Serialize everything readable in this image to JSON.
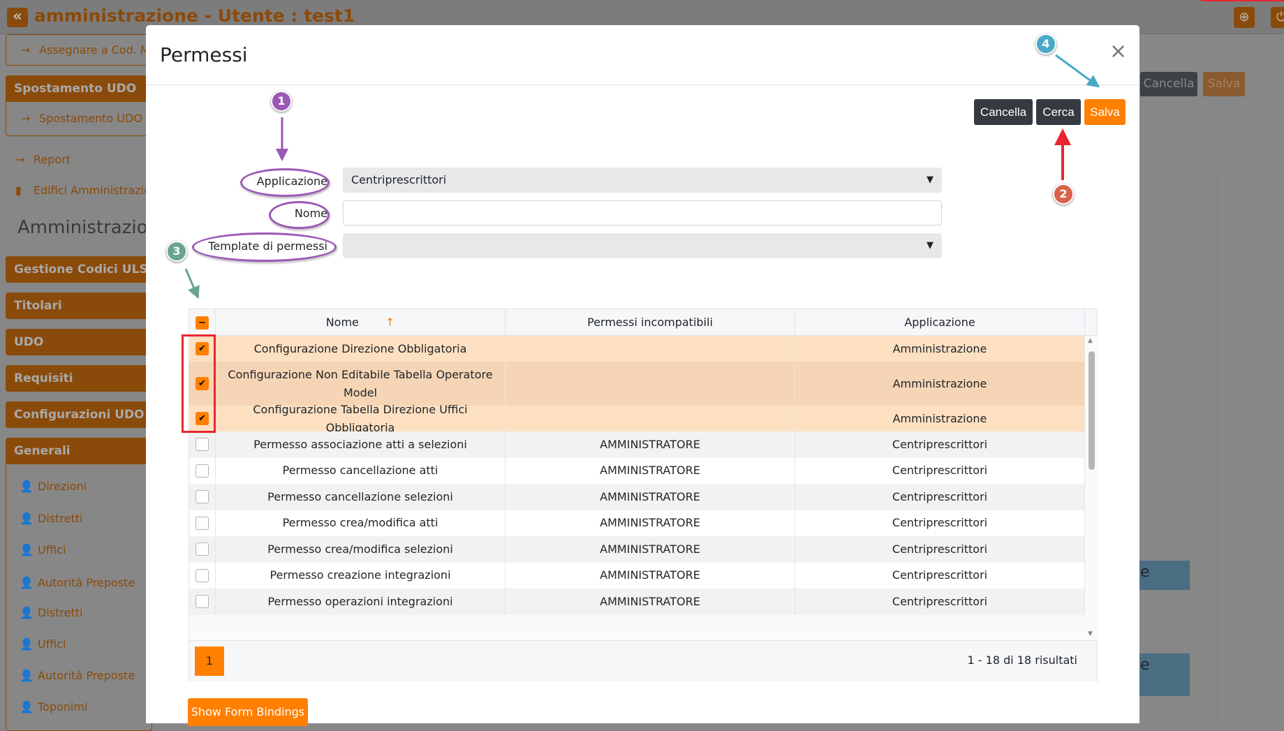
{
  "app": {
    "title": "amministrazione - Utente : test1",
    "collapse_icon": "double-chevron-left-icon",
    "globe_icon": "globe-icon",
    "power_icon": "power-icon"
  },
  "sidebar": {
    "assign_item": "Assegnare a Cod. M",
    "spostamento_header": "Spostamento UDO",
    "spostamento_item": "Spostamento UDO",
    "report": "Report",
    "edifici": "Edifici Amministrazioni",
    "heading": "Amministrazione",
    "sections": [
      "Gestione Codici ULSS",
      "Titolari",
      "UDO",
      "Requisiti",
      "Configurazioni UDO",
      "Generali"
    ],
    "generali_items": [
      "Direzioni",
      "Distretti",
      "Uffici",
      "Autorità Preposte",
      "Distretti",
      "Uffici",
      "Autorità Preposte",
      "Toponimi"
    ]
  },
  "background": {
    "cancel": "Cancella",
    "save": "Salva",
    "blue_1": "e",
    "blue_2": "e"
  },
  "modal": {
    "title": "Permessi",
    "close": "×",
    "buttons": {
      "cancel": "Cancella",
      "search": "Cerca",
      "save": "Salva"
    },
    "form": {
      "app_label": "Applicazione",
      "app_value": "Centriprescrittori",
      "name_label": "Nome",
      "name_value": "",
      "template_label": "Template di permessi",
      "template_value": ""
    },
    "table": {
      "columns": [
        "Nome",
        "Permessi incompatibili",
        "Applicazione"
      ],
      "sort": "↑",
      "rows": [
        {
          "checked": true,
          "nome": "Configurazione Direzione Obbligatoria",
          "incompatibili": "",
          "applicazione": "Amministrazione"
        },
        {
          "checked": true,
          "nome": "Configurazione Non Editabile Tabella Operatore Model",
          "incompatibili": "",
          "applicazione": "Amministrazione"
        },
        {
          "checked": true,
          "nome": "Configurazione Tabella Direzione Uffici Obbligatoria",
          "incompatibili": "",
          "applicazione": "Amministrazione"
        },
        {
          "checked": false,
          "nome": "Permesso associazione atti a selezioni",
          "incompatibili": "AMMINISTRATORE",
          "applicazione": "Centriprescrittori"
        },
        {
          "checked": false,
          "nome": "Permesso cancellazione atti",
          "incompatibili": "AMMINISTRATORE",
          "applicazione": "Centriprescrittori"
        },
        {
          "checked": false,
          "nome": "Permesso cancellazione selezioni",
          "incompatibili": "AMMINISTRATORE",
          "applicazione": "Centriprescrittori"
        },
        {
          "checked": false,
          "nome": "Permesso crea/modifica atti",
          "incompatibili": "AMMINISTRATORE",
          "applicazione": "Centriprescrittori"
        },
        {
          "checked": false,
          "nome": "Permesso crea/modifica selezioni",
          "incompatibili": "AMMINISTRATORE",
          "applicazione": "Centriprescrittori"
        },
        {
          "checked": false,
          "nome": "Permesso creazione integrazioni",
          "incompatibili": "AMMINISTRATORE",
          "applicazione": "Centriprescrittori"
        },
        {
          "checked": false,
          "nome": "Permesso operazioni integrazioni",
          "incompatibili": "AMMINISTRATORE",
          "applicazione": "Centriprescrittori"
        }
      ],
      "page": "1",
      "count": "1 - 18 di 18 risultati"
    },
    "show_bindings": "Show Form Bindings"
  },
  "annotations": [
    "1",
    "2",
    "3",
    "4"
  ],
  "colors": {
    "accent": "#ff8000",
    "selected_row": "#fde0c2",
    "dark_button": "#343a40",
    "ann1": "#9b59b6",
    "ann2": "#d9634a",
    "ann3": "#6aa58f",
    "ann4": "#4aa8c8",
    "highlight": "#e8262e"
  }
}
